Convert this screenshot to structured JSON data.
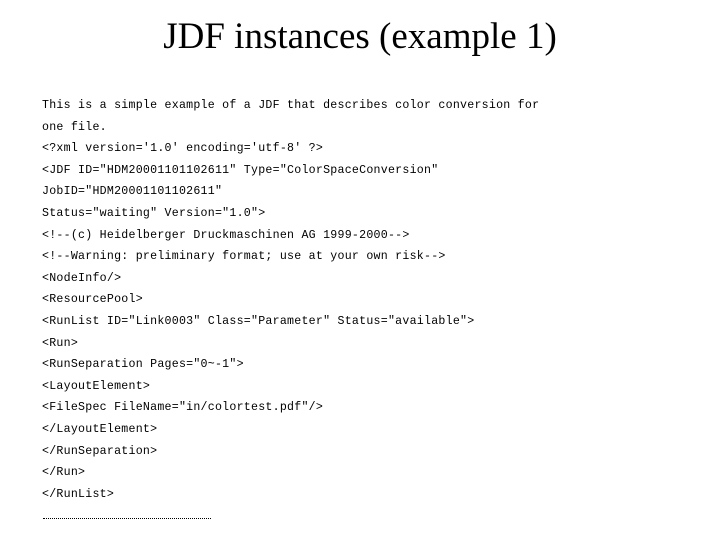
{
  "slide": {
    "title": "JDF instances (example 1)",
    "lines": [
      "This is a simple example of a JDF that describes color conversion for",
      "one file.",
      "<?xml version='1.0' encoding='utf-8' ?>",
      "<JDF ID=\"HDM20001101102611\" Type=\"ColorSpaceConversion\"",
      "JobID=\"HDM20001101102611\"",
      "Status=\"waiting\" Version=\"1.0\">",
      "<!--(c) Heidelberger Druckmaschinen AG 1999-2000-->",
      "<!--Warning: preliminary format; use at your own risk-->",
      "<NodeInfo/>",
      "<ResourcePool>",
      "<RunList ID=\"Link0003\" Class=\"Parameter\" Status=\"available\">",
      "<Run>",
      "<RunSeparation Pages=\"0~-1\">",
      "<LayoutElement>",
      "<FileSpec FileName=\"in/colortest.pdf\"/>",
      "</LayoutElement>",
      "</RunSeparation>",
      "</Run>",
      "</RunList>"
    ],
    "continuation_marker": "........................................................"
  }
}
